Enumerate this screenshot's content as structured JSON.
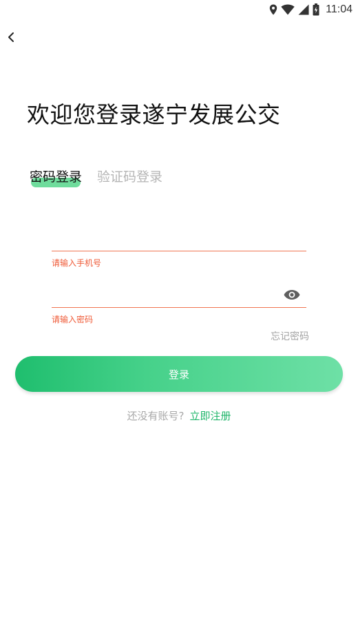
{
  "status_bar": {
    "time": "11:04",
    "icons": [
      "location-icon",
      "wifi-icon",
      "cell-signal-icon",
      "battery-icon"
    ]
  },
  "nav": {
    "back_icon": "chevron-left-icon"
  },
  "page": {
    "title": "欢迎您登录遂宁发展公交"
  },
  "tabs": [
    {
      "label": "密码登录",
      "active": true
    },
    {
      "label": "验证码登录",
      "active": false
    }
  ],
  "form": {
    "phone": {
      "value": "",
      "error": "请输入手机号"
    },
    "password": {
      "value": "",
      "error": "请输入密码",
      "toggle_icon": "eye-icon"
    },
    "forgot_label": "忘记密码",
    "submit_label": "登录"
  },
  "register": {
    "prompt": "还没有账号?",
    "link_label": "立即注册"
  },
  "colors": {
    "accent": "#1db569",
    "tab_highlight": "#6fdc9c",
    "error": "#ef5a37",
    "underline": "#f0734f",
    "muted": "#a8a8a8"
  }
}
